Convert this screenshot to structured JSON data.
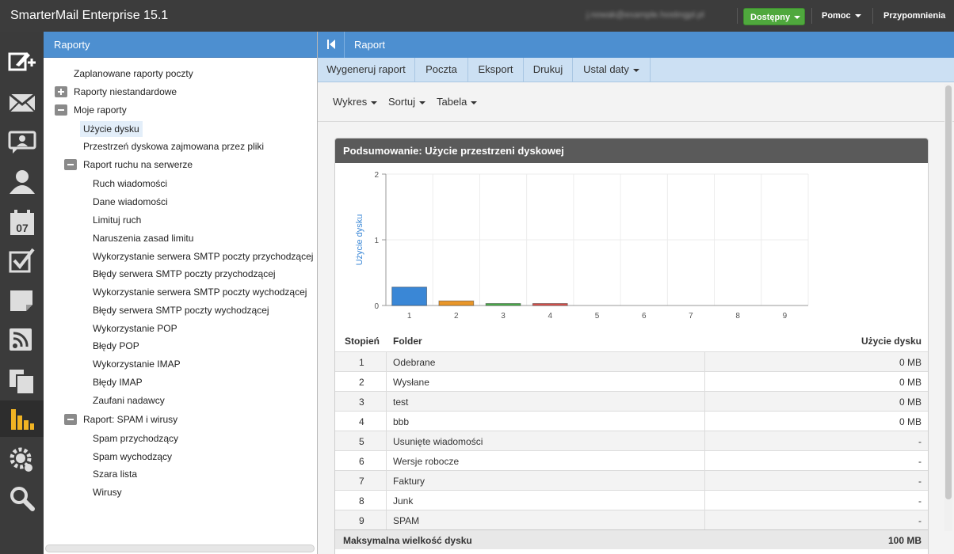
{
  "app": {
    "title": "SmarterMail Enterprise 15.1",
    "user_email": "j.nowak@example.hostingpl.pl",
    "status_label": "Dostępny",
    "help_label": "Pomoc",
    "reminders_label": "Przypomnienia",
    "colors": {
      "accent": "#4d8fd0",
      "status": "#4fa83d",
      "bar_active": "#f0b323"
    }
  },
  "sidebar_icons": [
    "compose-icon",
    "mail-icon",
    "chat-icon",
    "contacts-icon",
    "calendar-icon",
    "tasks-icon",
    "notes-icon",
    "rss-icon",
    "files-icon",
    "reports-icon",
    "settings-icon",
    "search-icon"
  ],
  "calendar_day": "07",
  "left_panel": {
    "title": "Raporty",
    "items": [
      {
        "label": "Zaplanowane raporty poczty"
      },
      {
        "label": "Raporty niestandardowe"
      },
      {
        "label": "Moje raporty"
      },
      {
        "label": "Użycie dysku"
      },
      {
        "label": "Przestrzeń dyskowa zajmowana przez pliki"
      },
      {
        "label": "Raport ruchu na serwerze"
      },
      {
        "label": "Ruch wiadomości"
      },
      {
        "label": "Dane wiadomości"
      },
      {
        "label": "Limituj ruch"
      },
      {
        "label": "Naruszenia zasad limitu"
      },
      {
        "label": "Wykorzystanie serwera SMTP poczty przychodzącej"
      },
      {
        "label": "Błędy serwera SMTP poczty przychodzącej"
      },
      {
        "label": "Wykorzystanie serwera SMTP poczty wychodzącej"
      },
      {
        "label": "Błędy serwera SMTP poczty wychodzącej"
      },
      {
        "label": "Wykorzystanie POP"
      },
      {
        "label": "Błędy POP"
      },
      {
        "label": "Wykorzystanie IMAP"
      },
      {
        "label": "Błędy IMAP"
      },
      {
        "label": "Zaufani nadawcy"
      },
      {
        "label": "Raport: SPAM i wirusy"
      },
      {
        "label": "Spam przychodzący"
      },
      {
        "label": "Spam wychodzący"
      },
      {
        "label": "Szara lista"
      },
      {
        "label": "Wirusy"
      }
    ]
  },
  "main": {
    "title": "Raport",
    "toolbar": [
      "Wygeneruj raport",
      "Poczta",
      "Eksport",
      "Drukuj",
      "Ustal daty"
    ],
    "subtoolbar": [
      "Wykres",
      "Sortuj",
      "Tabela"
    ],
    "card_title": "Podsumowanie: Użycie przestrzeni dyskowej",
    "table": {
      "headers": [
        "Stopień",
        "Folder",
        "Użycie dysku"
      ],
      "rows": [
        [
          "1",
          "Odebrane",
          "0 MB"
        ],
        [
          "2",
          "Wysłane",
          "0 MB"
        ],
        [
          "3",
          "test",
          "0 MB"
        ],
        [
          "4",
          "bbb",
          "0 MB"
        ],
        [
          "5",
          "Usunięte wiadomości",
          "-"
        ],
        [
          "6",
          "Wersje robocze",
          "-"
        ],
        [
          "7",
          "Faktury",
          "-"
        ],
        [
          "8",
          "Junk",
          "-"
        ],
        [
          "9",
          "SPAM",
          "-"
        ]
      ],
      "footer_label": "Maksymalna wielkość dysku",
      "footer_value": "100 MB"
    }
  },
  "chart_data": {
    "type": "bar",
    "categories": [
      "1",
      "2",
      "3",
      "4",
      "5",
      "6",
      "7",
      "8",
      "9"
    ],
    "values": [
      0.28,
      0.07,
      0.03,
      0.03,
      0,
      0,
      0,
      0,
      0
    ],
    "colors": [
      "#3a87d6",
      "#e8962a",
      "#4cae4c",
      "#d9534f",
      "#999999",
      "#999999",
      "#999999",
      "#999999",
      "#999999"
    ],
    "ylabel": "Użycie dysku",
    "ylim": [
      0,
      2
    ],
    "yticks": [
      "0",
      "1",
      "2"
    ],
    "grid": true
  }
}
